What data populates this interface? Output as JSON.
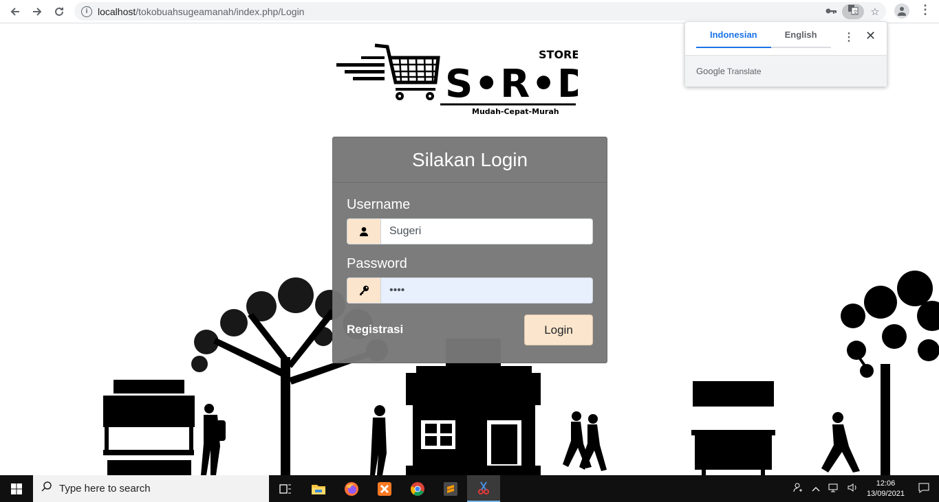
{
  "browser": {
    "url_host": "localhost",
    "url_path": "/tokobuahsugeamanah/index.php/Login"
  },
  "translate_popup": {
    "tabs": [
      "Indonesian",
      "English"
    ],
    "footer_brand": "Google",
    "footer_text": "Translate"
  },
  "logo": {
    "store_text": "STORE",
    "brand_text": "S•R•D",
    "tagline": "Mudah-Cepat-Murah"
  },
  "login": {
    "title": "Silakan Login",
    "username_label": "Username",
    "username_value": "Sugeri",
    "password_label": "Password",
    "password_value": "••••",
    "register_link": "Registrasi",
    "login_button": "Login"
  },
  "taskbar": {
    "search_placeholder": "Type here to search",
    "time": "12:06",
    "date": "13/09/2021"
  },
  "colors": {
    "accent_input_addon": "#fbe5cc",
    "card_bg": "#787878",
    "translate_active": "#1a73e8"
  }
}
